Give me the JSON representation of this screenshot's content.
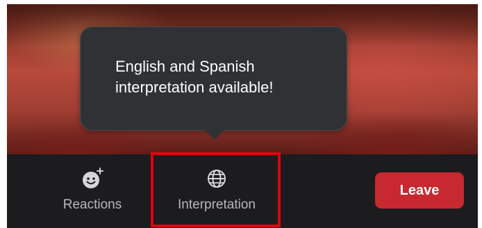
{
  "tooltip": {
    "line1": "English and Spanish",
    "line2": "interpretation available!"
  },
  "toolbar": {
    "reactions": {
      "label": "Reactions",
      "icon": "smiley-plus-icon"
    },
    "interpretation": {
      "label": "Interpretation",
      "icon": "globe-icon"
    },
    "leave": {
      "label": "Leave"
    }
  },
  "colors": {
    "toolbar_bg": "#1c1c1e",
    "tooltip_bg": "#2f3134",
    "leave_button": "#c8282f",
    "highlight": "#e3000f",
    "label_text": "#b9b9bd"
  }
}
